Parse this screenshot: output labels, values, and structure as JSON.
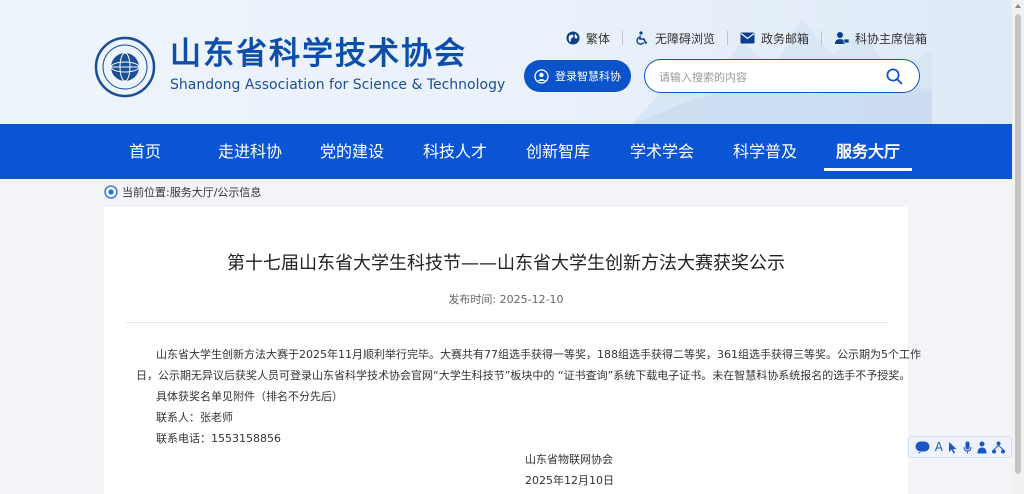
{
  "header": {
    "org_name_cn": "山东省科学技术协会",
    "org_name_en": "Shandong Association for Science & Technology",
    "top_links": [
      {
        "label": "繁体",
        "icon": "globe-icon"
      },
      {
        "label": "无障碍浏览",
        "icon": "accessibility-icon"
      },
      {
        "label": "政务邮箱",
        "icon": "mail-icon"
      },
      {
        "label": "科协主席信箱",
        "icon": "user-mailbox-icon"
      }
    ],
    "login_label": "登录智慧科协",
    "search_placeholder": "请输入搜索的内容"
  },
  "nav": {
    "items": [
      "首页",
      "走进科协",
      "党的建设",
      "科技人才",
      "创新智库",
      "学术学会",
      "科学普及",
      "服务大厅"
    ],
    "active_index": 7
  },
  "breadcrumb": {
    "prefix": "当前位置:",
    "path": "服务大厅/公示信息"
  },
  "article": {
    "title": "第十七届山东省大学生科技节——山东省大学生创新方法大赛获奖公示",
    "publish_date": "发布时间:  2025-12-10",
    "paragraph_line1": "山东省大学生创新方法大赛于2025年11月顺利举行完毕。大赛共有77组选手获得一等奖，188组选手获得二等奖，361组选手获得三等奖。公示期为5个工作",
    "paragraph_line2": "日，公示期无异议后获奖人员可登录山东省科学技术协会官网“大学生科技节”板块中的 “证书查询”系统下载电子证书。未在智慧科协系统报名的选手不予授奖。",
    "attachment_note": "具体获奖名单见附件（排名不分先后）",
    "contact": "联系人：张老师",
    "phone": "联系电话：1553158856",
    "signature_org": "山东省物联网协会",
    "signature_date": "2025年12月10日"
  },
  "a11y_toolbar": {
    "text_size_label": "A",
    "icons": [
      "speech-icon",
      "text-size-icon",
      "pointer-icon",
      "microphone-icon",
      "person-icon",
      "network-icon"
    ]
  },
  "colors": {
    "primary_blue": "#0a55d6",
    "brand_text": "#0d4fa8",
    "button_blue": "#0a53c8"
  }
}
